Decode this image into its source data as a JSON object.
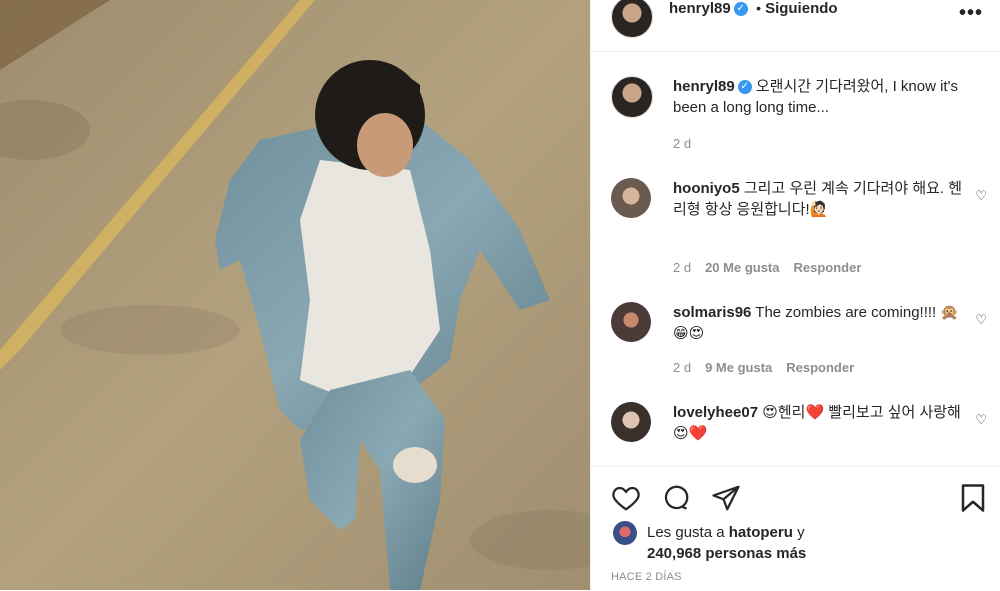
{
  "header": {
    "username": "henryl89",
    "dot": "•",
    "follow_status": "Siguiendo",
    "more_icon": "more-horizontal-icon"
  },
  "caption": {
    "username": "henryl89",
    "text": "오랜시간 기다려왔어, I know it's been a long long time...",
    "time": "2 d"
  },
  "comments": [
    {
      "username": "hooniyo5",
      "text": "그리고 우린 계속 기다려야 해요. 헨리형 항상 응원합니다!🙋🏻",
      "time": "2 d",
      "likes": "20 Me gusta",
      "reply": "Responder"
    },
    {
      "username": "solmaris96",
      "text": "The zombies are coming!!!! 🙊😁😍",
      "time": "2 d",
      "likes": "9 Me gusta",
      "reply": "Responder"
    },
    {
      "username": "lovelyhee07",
      "text": "😍헨리❤️ 빨리보고 싶어 사랑해😍❤️"
    }
  ],
  "likes": {
    "prefix": "Les gusta a ",
    "user": "hatoperu",
    "mid": " y",
    "count": "240,968 personas más"
  },
  "timestamp": "HACE 2 DÍAS",
  "colors": {
    "verified": "#3897f0",
    "muted": "#8e8e8e",
    "text": "#262626"
  }
}
